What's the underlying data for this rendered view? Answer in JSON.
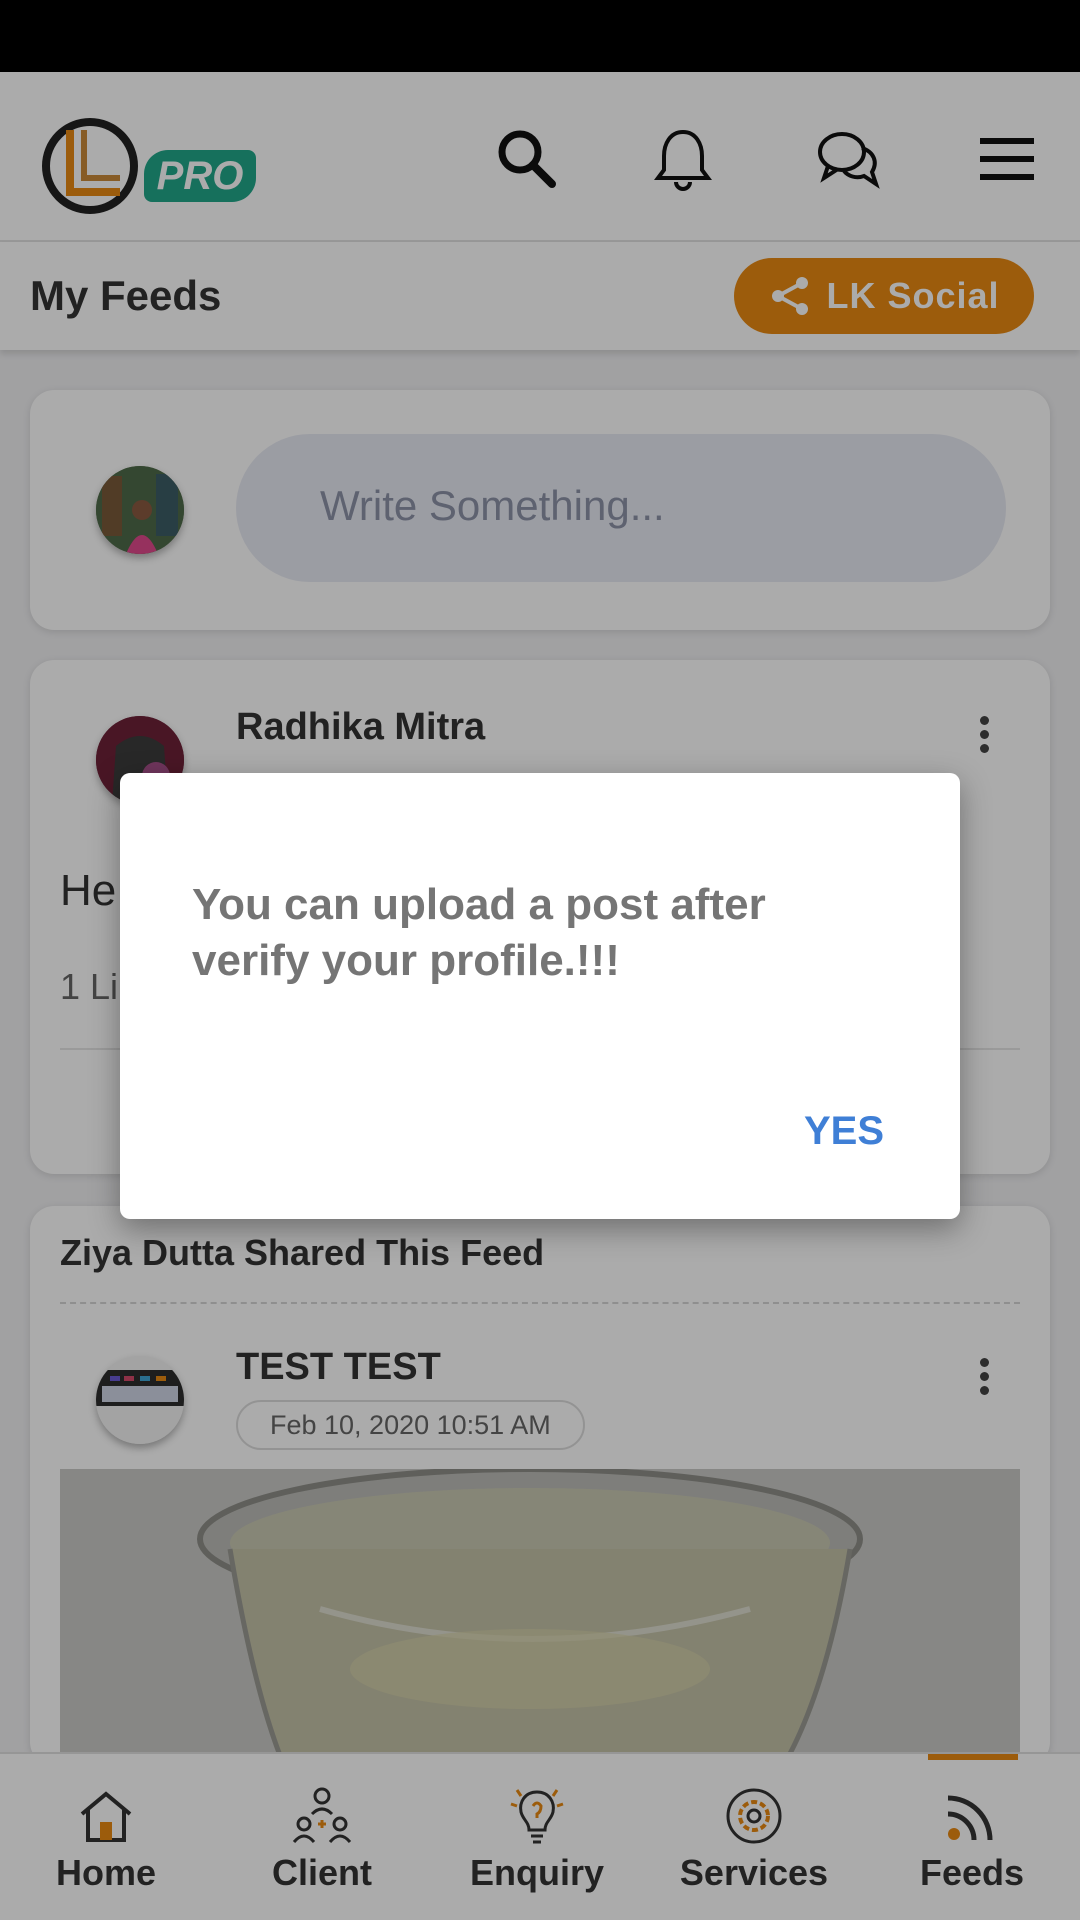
{
  "header": {
    "logo_badge": "PRO",
    "icons": [
      "search-icon",
      "bell-icon",
      "chat-icon",
      "menu-icon"
    ]
  },
  "subheader": {
    "title": "My Feeds",
    "social_button": "LK Social"
  },
  "composer": {
    "placeholder": "Write Something..."
  },
  "posts": [
    {
      "author": "Radhika Mitra",
      "text": "He",
      "likes": "1 Li"
    },
    {
      "shared_by": "Ziya Dutta Shared This Feed",
      "author": "TEST TEST",
      "date": "Feb 10, 2020 10:51 AM"
    }
  ],
  "dialog": {
    "message": "You can upload a post after verify your profile.!!!",
    "confirm": "YES"
  },
  "bottom_nav": {
    "items": [
      {
        "label": "Home",
        "icon": "home-icon"
      },
      {
        "label": "Client",
        "icon": "client-icon"
      },
      {
        "label": "Enquiry",
        "icon": "bulb-icon"
      },
      {
        "label": "Services",
        "icon": "services-icon"
      },
      {
        "label": "Feeds",
        "icon": "feeds-icon"
      }
    ],
    "active": "Feeds"
  },
  "colors": {
    "accent": "#e98a12",
    "brand_green": "#22a78a",
    "link_blue": "#3f7fd6"
  }
}
